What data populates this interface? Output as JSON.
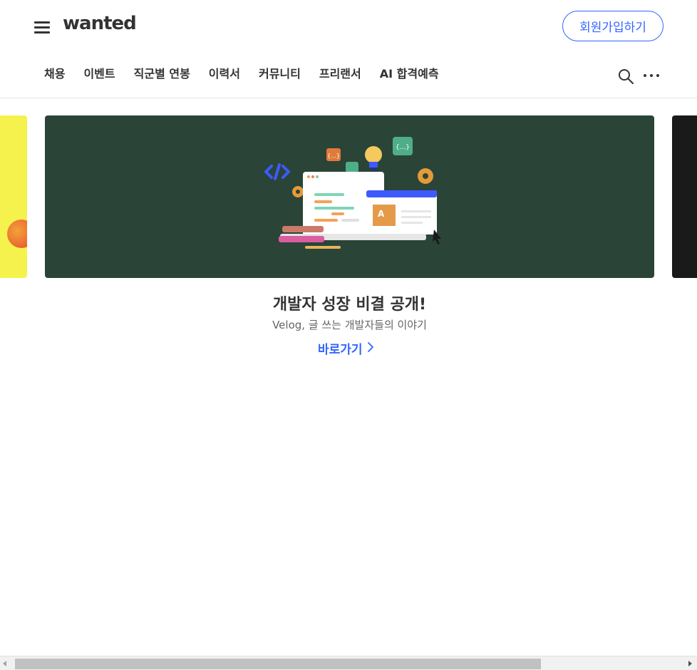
{
  "header": {
    "logo": "wanted",
    "signup_label": "회원가입하기",
    "nav": [
      {
        "label": "채용"
      },
      {
        "label": "이벤트"
      },
      {
        "label": "직군별 연봉"
      },
      {
        "label": "이력서"
      },
      {
        "label": "커뮤니티"
      },
      {
        "label": "프리랜서"
      },
      {
        "label": "AI 합격예측"
      }
    ],
    "icons": [
      "menu-icon",
      "search-icon",
      "more-icon"
    ]
  },
  "carousel": {
    "active": {
      "title": "개발자 성장 비결 공개!",
      "subtitle": "Velog, 글 쓰는 개발자들의 이야기",
      "link_label": "바로가기",
      "background": "#2a4438"
    },
    "prev_background": "#f6f24d",
    "next_background": "#1a1a1a"
  },
  "colors": {
    "accent": "#3366ff",
    "text": "#333333"
  }
}
